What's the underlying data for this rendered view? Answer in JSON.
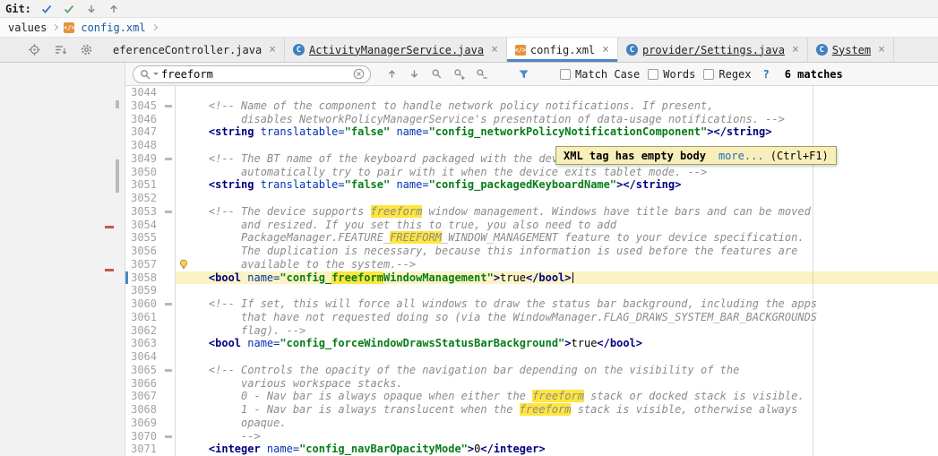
{
  "close_glyph": "×",
  "git_bar": {
    "label": "Git:"
  },
  "breadcrumbs": {
    "folder": "values",
    "file": "config.xml"
  },
  "icons": {
    "git": [
      "check-blue-icon",
      "check-green-icon",
      "arrow-down-icon",
      "arrow-up-icon"
    ],
    "tab_tools": [
      "locate-file-icon",
      "sort-tabs-icon",
      "gear-icon"
    ],
    "find": [
      "search-icon",
      "clear-search-icon",
      "previous-match-icon",
      "next-match-icon",
      "find-occurrence-icon",
      "add-occurrence-icon",
      "remove-occurrence-icon",
      "filter-funnel-icon"
    ],
    "editor": [
      "lightbulb-icon"
    ]
  },
  "tabs": [
    {
      "label": "eferenceController.java",
      "icon": "",
      "active": false,
      "underlined": false
    },
    {
      "label": "ActivityManagerService.java",
      "icon": "class-icon",
      "active": false,
      "underlined": true
    },
    {
      "label": "config.xml",
      "icon": "xml-file-icon",
      "active": true,
      "underlined": false
    },
    {
      "label": "provider/Settings.java",
      "icon": "class-icon",
      "active": false,
      "underlined": true
    },
    {
      "label": "System",
      "icon": "class-icon",
      "active": false,
      "underlined": true
    }
  ],
  "find_bar": {
    "query": "freeform",
    "match_case_label": "Match Case",
    "words_label": "Words",
    "regex_label": "Regex",
    "help_label": "?",
    "matches_label": "6 matches"
  },
  "colors": {
    "accent_blue": "#4a88c7",
    "search_highlight": "#ffe53e",
    "caret_line_bg": "#fcf3c5",
    "tooltip_bg": "#f7eeba",
    "tag": "#000080",
    "attribute": "#0033b3",
    "value": "#067d17",
    "comment": "#8c8c8c"
  },
  "editor": {
    "tooltip": {
      "text": "XML tag has empty body",
      "link": "more...",
      "shortcut": " (Ctrl+F1)"
    },
    "lines": [
      {
        "num": 3044,
        "tokens": []
      },
      {
        "num": 3045,
        "fold": true,
        "tokens": [
          {
            "s": "c",
            "t": "    <!-- Name of the component to handle network policy notifications. If present,"
          }
        ]
      },
      {
        "num": 3046,
        "tokens": [
          {
            "s": "c",
            "t": "         disables NetworkPolicyManagerService's presentation of data-usage notifications. -->"
          }
        ]
      },
      {
        "num": 3047,
        "tokens": [
          {
            "s": "p",
            "t": "    "
          },
          {
            "s": "t",
            "t": "<string"
          },
          {
            "s": "a",
            "t": " translatable="
          },
          {
            "s": "s",
            "t": "\"false\""
          },
          {
            "s": "a",
            "t": " name="
          },
          {
            "s": "s",
            "t": "\"config_networkPolicyNotificationComponent\""
          },
          {
            "s": "t",
            "t": "></string>"
          }
        ]
      },
      {
        "num": 3048,
        "tokens": []
      },
      {
        "num": 3049,
        "fold": true,
        "tokens": [
          {
            "s": "c",
            "t": "    <!-- The BT name of the keyboard packaged with the dev"
          }
        ]
      },
      {
        "num": 3050,
        "tokens": [
          {
            "s": "c",
            "t": "         automatically try to pair with it when the device exits tablet mode. -->"
          }
        ]
      },
      {
        "num": 3051,
        "tokens": [
          {
            "s": "p",
            "t": "    "
          },
          {
            "s": "t",
            "t": "<string"
          },
          {
            "s": "a",
            "t": " translatable="
          },
          {
            "s": "s",
            "t": "\"false\""
          },
          {
            "s": "a",
            "t": " name="
          },
          {
            "s": "s",
            "t": "\"config_packagedKeyboardName\""
          },
          {
            "s": "t",
            "t": "></string>"
          }
        ]
      },
      {
        "num": 3052,
        "tokens": []
      },
      {
        "num": 3053,
        "fold": true,
        "tokens": [
          {
            "s": "c",
            "t": "    <!-- The device supports "
          },
          {
            "s": "c",
            "t": "freeform",
            "h": true
          },
          {
            "s": "c",
            "t": " window management. Windows have title bars and can be moved"
          }
        ]
      },
      {
        "num": 3054,
        "tokens": [
          {
            "s": "c",
            "t": "         and resized. If you set this to true, you also need to add"
          }
        ]
      },
      {
        "num": 3055,
        "tokens": [
          {
            "s": "c",
            "t": "         PackageManager.FEATURE_"
          },
          {
            "s": "c",
            "t": "FREEFORM",
            "h": true
          },
          {
            "s": "c",
            "t": "_WINDOW_MANAGEMENT feature to your device specification."
          }
        ]
      },
      {
        "num": 3056,
        "tokens": [
          {
            "s": "c",
            "t": "         The duplication is necessary, because this information is used before the features are"
          }
        ]
      },
      {
        "num": 3057,
        "bulb": true,
        "tokens": [
          {
            "s": "c",
            "t": "         available to the system.-->"
          }
        ]
      },
      {
        "num": 3058,
        "current": true,
        "caret": true,
        "tokens": [
          {
            "s": "p",
            "t": "    "
          },
          {
            "s": "t",
            "t": "<bool"
          },
          {
            "s": "a",
            "t": " name="
          },
          {
            "s": "s",
            "t": "\"config_"
          },
          {
            "s": "s",
            "t": "freeform",
            "h": true
          },
          {
            "s": "s",
            "t": "WindowManagement\""
          },
          {
            "s": "t",
            "t": ">"
          },
          {
            "s": "p",
            "t": "true"
          },
          {
            "s": "t",
            "t": "</bool>"
          }
        ]
      },
      {
        "num": 3059,
        "tokens": []
      },
      {
        "num": 3060,
        "fold": true,
        "tokens": [
          {
            "s": "c",
            "t": "    <!-- If set, this will force all windows to draw the status bar background, including the apps"
          }
        ]
      },
      {
        "num": 3061,
        "tokens": [
          {
            "s": "c",
            "t": "         that have not requested doing so (via the WindowManager.FLAG_DRAWS_SYSTEM_BAR_BACKGROUNDS"
          }
        ]
      },
      {
        "num": 3062,
        "tokens": [
          {
            "s": "c",
            "t": "         flag). -->"
          }
        ]
      },
      {
        "num": 3063,
        "tokens": [
          {
            "s": "p",
            "t": "    "
          },
          {
            "s": "t",
            "t": "<bool"
          },
          {
            "s": "a",
            "t": " name="
          },
          {
            "s": "s",
            "t": "\"config_forceWindowDrawsStatusBarBackground\""
          },
          {
            "s": "t",
            "t": ">"
          },
          {
            "s": "p",
            "t": "true"
          },
          {
            "s": "t",
            "t": "</bool>"
          }
        ]
      },
      {
        "num": 3064,
        "tokens": []
      },
      {
        "num": 3065,
        "fold": true,
        "tokens": [
          {
            "s": "c",
            "t": "    <!-- Controls the opacity of the navigation bar depending on the visibility of the"
          }
        ]
      },
      {
        "num": 3066,
        "tokens": [
          {
            "s": "c",
            "t": "         various workspace stacks."
          }
        ]
      },
      {
        "num": 3067,
        "tokens": [
          {
            "s": "c",
            "t": "         0 - Nav bar is always opaque when either the "
          },
          {
            "s": "c",
            "t": "freeform",
            "h": true
          },
          {
            "s": "c",
            "t": " stack or docked stack is visible."
          }
        ]
      },
      {
        "num": 3068,
        "tokens": [
          {
            "s": "c",
            "t": "         1 - Nav bar is always translucent when the "
          },
          {
            "s": "c",
            "t": "freeform",
            "h": true
          },
          {
            "s": "c",
            "t": " stack is visible, otherwise always"
          }
        ]
      },
      {
        "num": 3069,
        "tokens": [
          {
            "s": "c",
            "t": "         opaque."
          }
        ]
      },
      {
        "num": 3070,
        "fold": true,
        "tokens": [
          {
            "s": "c",
            "t": "         -->"
          }
        ]
      },
      {
        "num": 3071,
        "tokens": [
          {
            "s": "p",
            "t": "    "
          },
          {
            "s": "t",
            "t": "<integer"
          },
          {
            "s": "a",
            "t": " name="
          },
          {
            "s": "s",
            "t": "\"config_navBarOpacityMode\""
          },
          {
            "s": "t",
            "t": ">"
          },
          {
            "s": "p",
            "t": "0"
          },
          {
            "s": "t",
            "t": "</integer>"
          }
        ]
      }
    ]
  }
}
